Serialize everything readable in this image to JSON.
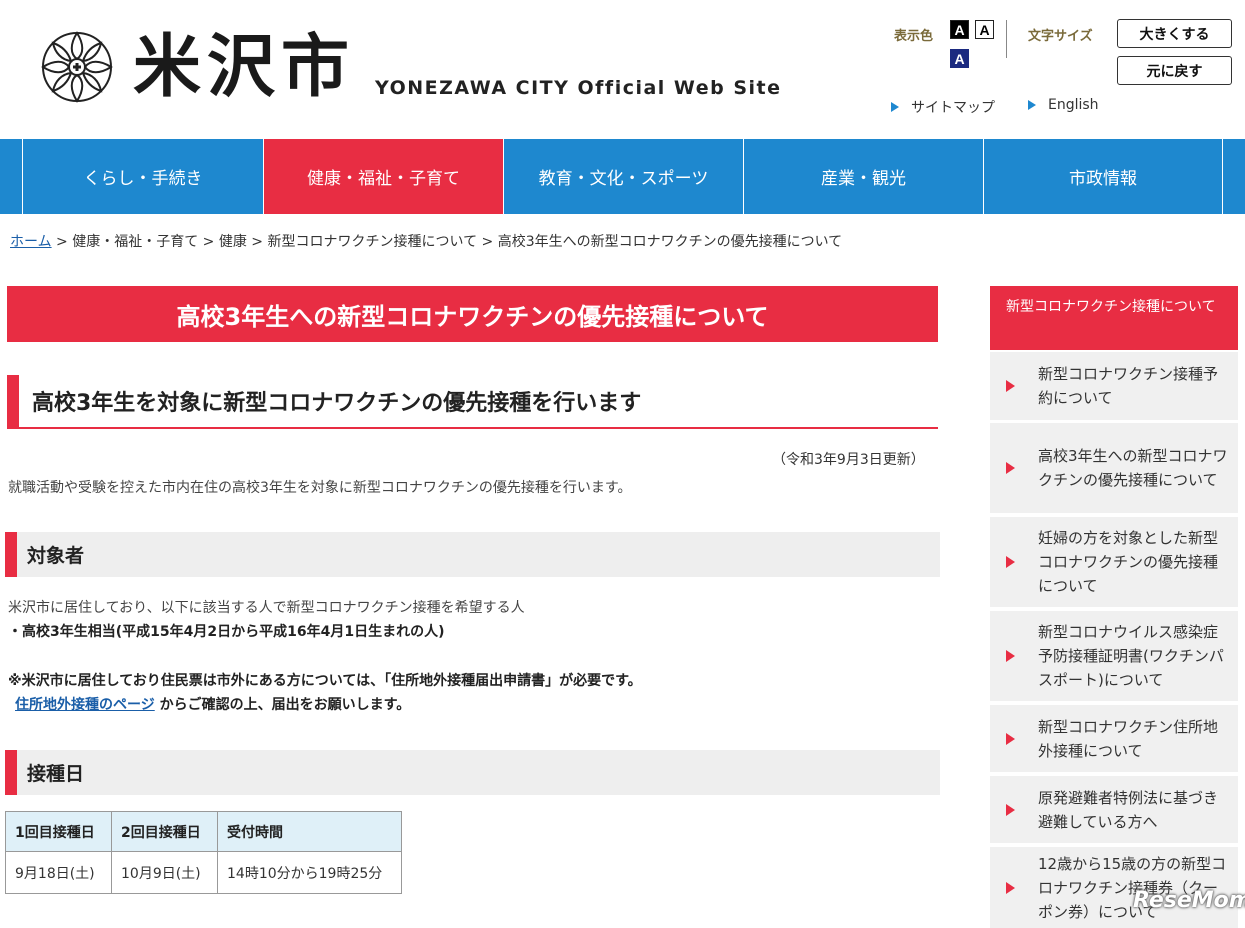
{
  "header": {
    "site_name": "米沢市",
    "site_subtitle": "YONEZAWA CITY Official Web Site",
    "display_color_label": "表示色",
    "color_options": [
      "A",
      "A",
      "A"
    ],
    "font_size_label": "文字サイズ",
    "enlarge_label": "大きくする",
    "reset_label": "元に戻す",
    "links": [
      "サイトマップ",
      "English"
    ]
  },
  "nav": {
    "items": [
      {
        "label": "くらし・手続き",
        "active": false
      },
      {
        "label": "健康・福祉・子育て",
        "active": true
      },
      {
        "label": "教育・文化・スポーツ",
        "active": false
      },
      {
        "label": "産業・観光",
        "active": false
      },
      {
        "label": "市政情報",
        "active": false
      }
    ]
  },
  "breadcrumb": {
    "home": "ホーム",
    "rest": " > 健康・福祉・子育て > 健康 > 新型コロナワクチン接種について > 高校3年生への新型コロナワクチンの優先接種について"
  },
  "main": {
    "title": "高校3年生への新型コロナワクチンの優先接種について",
    "heading": "高校3年生を対象に新型コロナワクチンの優先接種を行います",
    "updated": "（令和3年9月3日更新）",
    "intro": "就職活動や受験を控えた市内在住の高校3年生を対象に新型コロナワクチンの優先接種を行います。",
    "section_target": {
      "heading": "対象者",
      "line1": "米沢市に居住しており、以下に該当する人で新型コロナワクチン接種を希望する人",
      "line2": "・高校3年生相当(平成15年4月2日から平成16年4月1日生まれの人)",
      "note1": "※米沢市に居住しており住民票は市外にある方については、「住所地外接種届出申請書」が必要です。",
      "note_link": "住所地外接種のページ",
      "note2": " からご確認の上、届出をお願いします。"
    },
    "section_date": {
      "heading": "接種日",
      "table": {
        "headers": [
          "1回目接種日",
          "2回目接種日",
          "受付時間"
        ],
        "row": [
          "9月18日(土)",
          "10月9日(土)",
          "14時10分から19時25分"
        ]
      }
    }
  },
  "sidebar": {
    "heading": "新型コロナワクチン接種について",
    "items": [
      "新型コロナワクチン接種予約について",
      "高校3年生への新型コロナワクチンの優先接種について",
      "妊婦の方を対象とした新型コロナワクチンの優先接種について",
      "新型コロナウイルス感染症予防接種証明書(ワクチンパスポート)について",
      "新型コロナワクチン住所地外接種について",
      "原発避難者特例法に基づき避難している方へ",
      "12歳から15歳の方の新型コロナワクチン接種券（クーポン券）について"
    ]
  },
  "watermark": "ReseMom"
}
